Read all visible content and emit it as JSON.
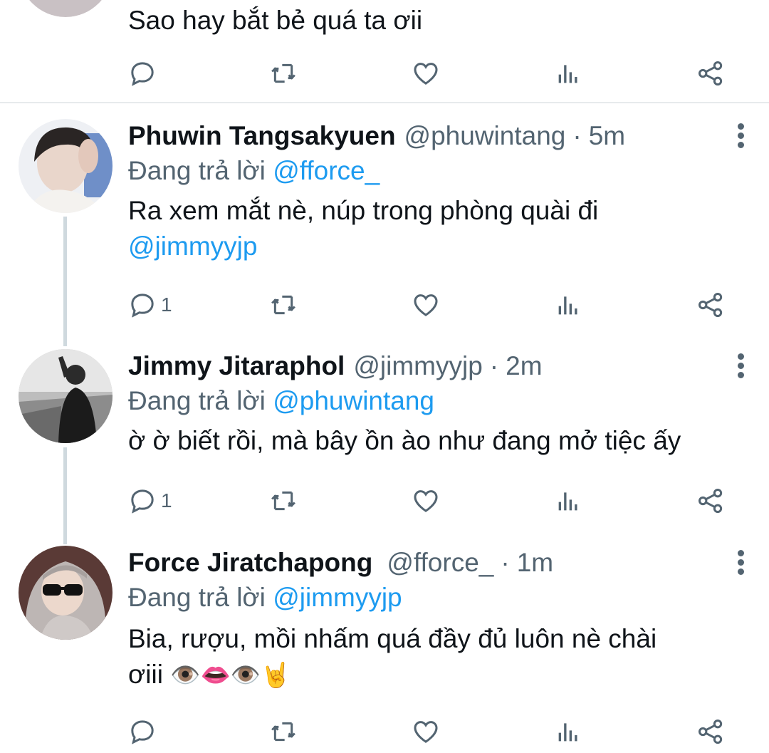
{
  "top_tweet": {
    "text": "Sao hay bắt bẻ quá ta ơii",
    "reply_count": "",
    "icons": [
      "reply-icon",
      "retweet-icon",
      "like-icon",
      "analytics-icon",
      "share-icon"
    ]
  },
  "tweets": [
    {
      "name": "Phuwin Tangsakyuen",
      "handle": "@phuwintang",
      "separator": "·",
      "time": "5m",
      "replying_prefix": "Đang trả lời",
      "replying_to": "@fforce_",
      "text": "Ra xem mắt nè, núp trong phòng quài đi",
      "text_mention": "@jimmyyjp",
      "reply_count": "1"
    },
    {
      "name": "Jimmy Jitaraphol",
      "handle": "@jimmyyjp",
      "separator": "·",
      "time": "2m",
      "replying_prefix": "Đang trả lời",
      "replying_to": "@phuwintang",
      "text": "ờ ờ biết rồi, mà bây ồn ào như đang mở tiệc ấy",
      "reply_count": "1"
    },
    {
      "name": "Force Jiratchapong",
      "handle": "@fforce_",
      "separator": "·",
      "time": "1m",
      "replying_prefix": "Đang trả lời",
      "replying_to": "@jimmyyjp",
      "text_line1": "Bia, rượu, mồi nhấm quá đầy đủ luôn nè chài",
      "text_line2": "ơiii",
      "emojis": "👁️👄👁️🤘",
      "reply_count": ""
    }
  ],
  "colors": {
    "link": "#1d9bf0",
    "secondary_text": "#536471",
    "primary_text": "#0f1419",
    "thread_line": "#cfd9de"
  }
}
